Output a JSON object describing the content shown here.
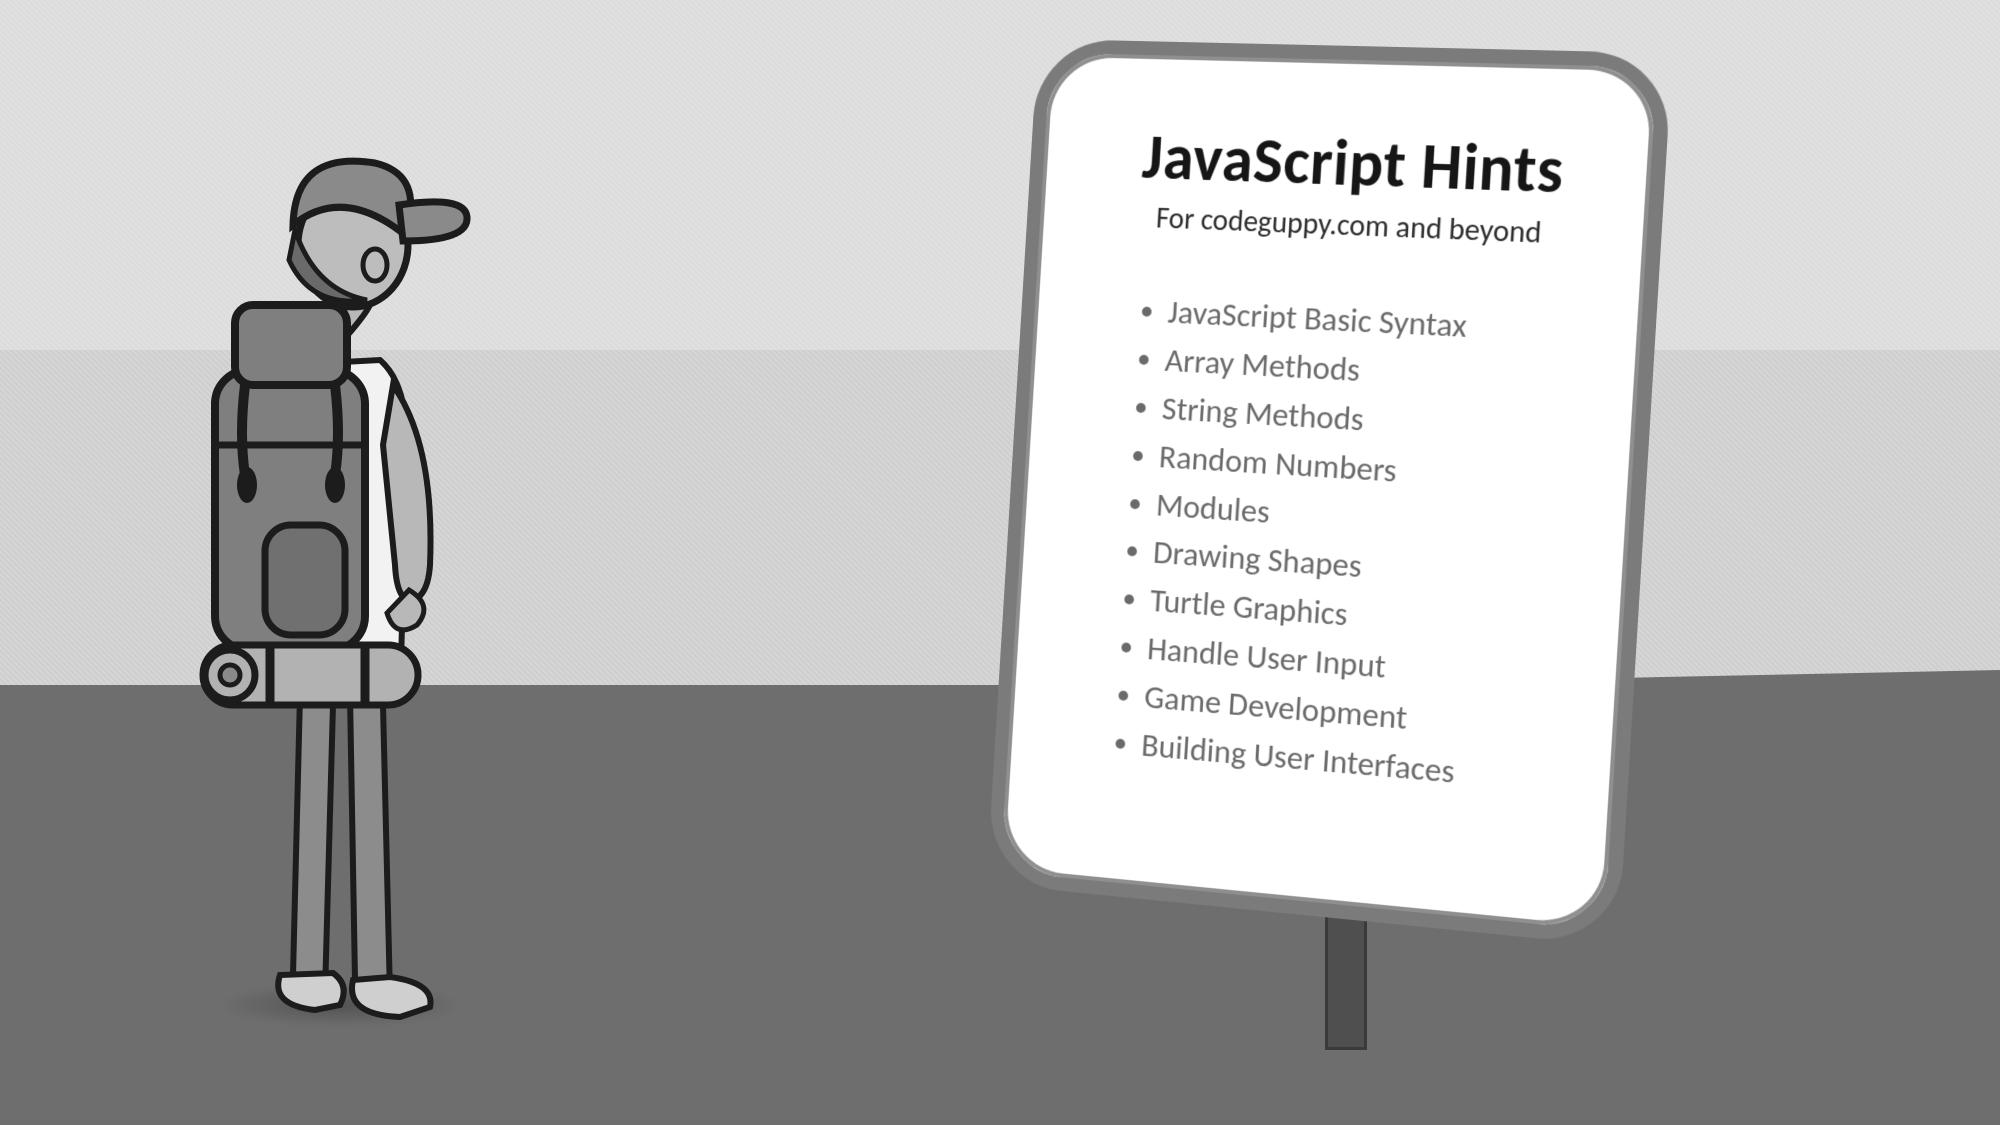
{
  "sign": {
    "title": "JavaScript Hints",
    "subtitle": "For codeguppy.com and beyond",
    "items": [
      "JavaScript Basic Syntax",
      "Array Methods",
      "String Methods",
      "Random Numbers",
      "Modules",
      "Drawing Shapes",
      "Turtle Graphics",
      "Handle User Input",
      "Game Development",
      "Building User Interfaces"
    ]
  }
}
